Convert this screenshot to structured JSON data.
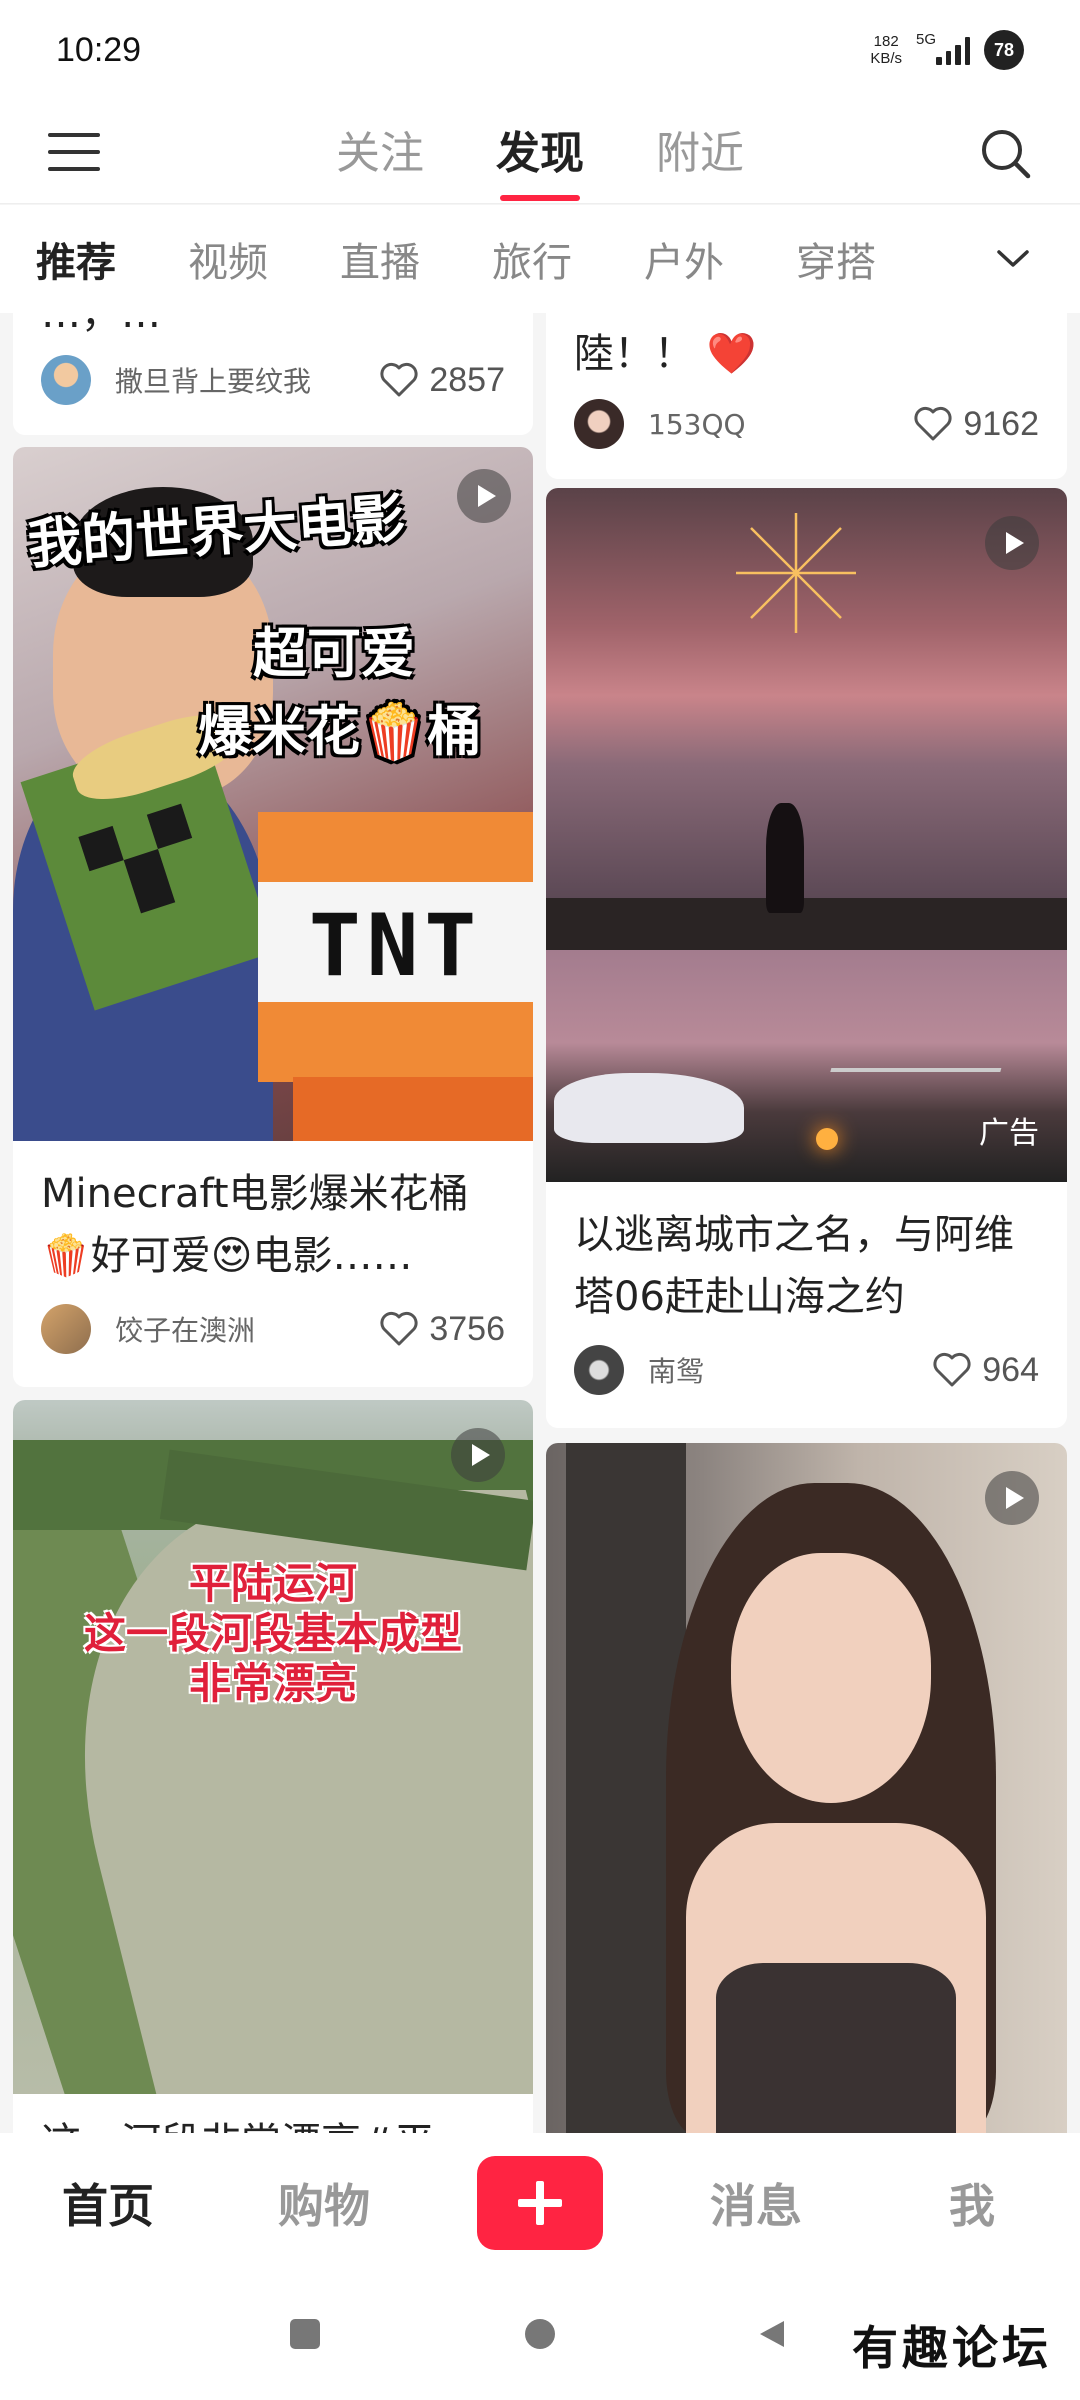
{
  "status_bar": {
    "time": "10:29",
    "net_speed_value": "182",
    "net_speed_unit": "KB/s",
    "network": "5G",
    "battery": "78"
  },
  "header": {
    "tabs": [
      "关注",
      "发现",
      "附近"
    ],
    "active_tab": "发现"
  },
  "categories": {
    "tabs": [
      "推荐",
      "视频",
      "直播",
      "旅行",
      "户外",
      "穿搭"
    ],
    "active": "推荐"
  },
  "feed": {
    "card1": {
      "title_fragment": "…，…",
      "author": "撒旦背上要纹我",
      "likes": "2857"
    },
    "card2": {
      "title_fragment": "陸！！",
      "title_emoji": "❤️",
      "author": "153QQ",
      "likes": "9162"
    },
    "card3": {
      "overlay_line1": "我的世界大电影",
      "overlay_line2": "超可爱",
      "overlay_line3": "爆米花🍿桶",
      "box_text": "TNT",
      "title": "Minecraft电影爆米花桶🍿好可爱😍电影……",
      "author": "饺子在澳洲",
      "likes": "3756"
    },
    "card4": {
      "ad_label": "广告",
      "title": "以逃离城市之名，与阿维塔06赶赴山海之约",
      "author": "南鸳",
      "likes": "964"
    },
    "card5": {
      "overlay_line1": "平陆运河",
      "overlay_line2": "这一段河段基本成型",
      "overlay_line3": "非常漂亮",
      "title_fragment": "这一河段非常漂亮#平"
    },
    "card6": {}
  },
  "bottom_nav": {
    "home": "首页",
    "shop": "购物",
    "messages": "消息",
    "me": "我"
  },
  "watermark": "有趣论坛",
  "colors": {
    "accent": "#ff2442",
    "background": "#f5f5f5"
  }
}
